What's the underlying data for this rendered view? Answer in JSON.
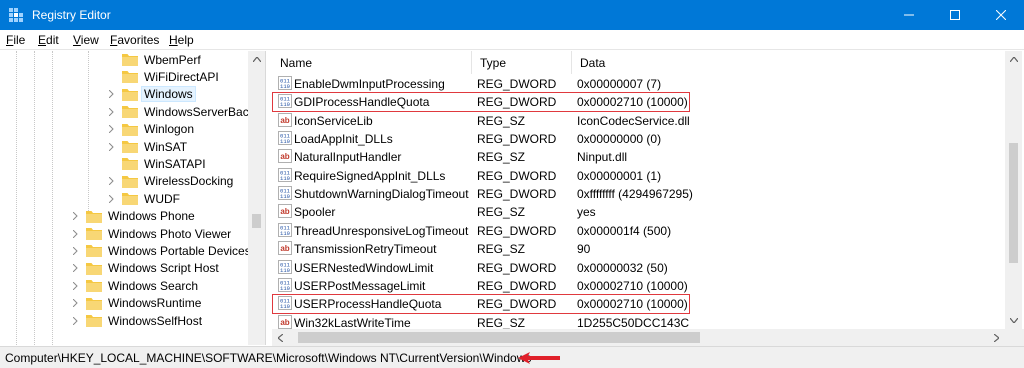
{
  "window": {
    "title": "Registry Editor",
    "accent": "#0078d7"
  },
  "menu": [
    {
      "label": "File",
      "underline": "F",
      "rest": "ile"
    },
    {
      "label": "Edit",
      "underline": "E",
      "rest": "dit"
    },
    {
      "label": "View",
      "underline": "V",
      "rest": "iew"
    },
    {
      "label": "Favorites",
      "underline": "F",
      "rest": "avorites"
    },
    {
      "label": "Help",
      "underline": "H",
      "rest": "elp"
    }
  ],
  "tree": {
    "items": [
      {
        "label": "WbemPerf",
        "expandable": false,
        "selected": false
      },
      {
        "label": "WiFiDirectAPI",
        "expandable": false,
        "selected": false
      },
      {
        "label": "Windows",
        "expandable": true,
        "selected": true
      },
      {
        "label": "WindowsServerBacku",
        "expandable": true,
        "selected": false
      },
      {
        "label": "Winlogon",
        "expandable": true,
        "selected": false
      },
      {
        "label": "WinSAT",
        "expandable": true,
        "selected": false
      },
      {
        "label": "WinSATAPI",
        "expandable": false,
        "selected": false
      },
      {
        "label": "WirelessDocking",
        "expandable": true,
        "selected": false
      },
      {
        "label": "WUDF",
        "expandable": true,
        "selected": false
      },
      {
        "label": "Windows Phone",
        "expandable": true,
        "selected": false
      },
      {
        "label": "Windows Photo Viewer",
        "expandable": true,
        "selected": false
      },
      {
        "label": "Windows Portable Devices",
        "expandable": true,
        "selected": false
      },
      {
        "label": "Windows Script Host",
        "expandable": true,
        "selected": false
      },
      {
        "label": "Windows Search",
        "expandable": true,
        "selected": false
      },
      {
        "label": "WindowsRuntime",
        "expandable": true,
        "selected": false
      },
      {
        "label": "WindowsSelfHost",
        "expandable": true,
        "selected": false
      }
    ]
  },
  "list": {
    "columns": [
      "Name",
      "Type",
      "Data"
    ],
    "rows": [
      {
        "icon": "dword-icon",
        "name": "EnableDwmInputProcessing",
        "type": "REG_DWORD",
        "data": "0x00000007 (7)",
        "highlighted": false
      },
      {
        "icon": "dword-icon",
        "name": "GDIProcessHandleQuota",
        "type": "REG_DWORD",
        "data": "0x00002710 (10000)",
        "highlighted": true
      },
      {
        "icon": "string-icon",
        "name": "IconServiceLib",
        "type": "REG_SZ",
        "data": "IconCodecService.dll",
        "highlighted": false
      },
      {
        "icon": "dword-icon",
        "name": "LoadAppInit_DLLs",
        "type": "REG_DWORD",
        "data": "0x00000000 (0)",
        "highlighted": false
      },
      {
        "icon": "string-icon",
        "name": "NaturalInputHandler",
        "type": "REG_SZ",
        "data": "Ninput.dll",
        "highlighted": false
      },
      {
        "icon": "dword-icon",
        "name": "RequireSignedAppInit_DLLs",
        "type": "REG_DWORD",
        "data": "0x00000001 (1)",
        "highlighted": false
      },
      {
        "icon": "dword-icon",
        "name": "ShutdownWarningDialogTimeout",
        "type": "REG_DWORD",
        "data": "0xffffffff (4294967295)",
        "highlighted": false
      },
      {
        "icon": "string-icon",
        "name": "Spooler",
        "type": "REG_SZ",
        "data": "yes",
        "highlighted": false
      },
      {
        "icon": "dword-icon",
        "name": "ThreadUnresponsiveLogTimeout",
        "type": "REG_DWORD",
        "data": "0x000001f4 (500)",
        "highlighted": false
      },
      {
        "icon": "string-icon",
        "name": "TransmissionRetryTimeout",
        "type": "REG_SZ",
        "data": "90",
        "highlighted": false
      },
      {
        "icon": "dword-icon",
        "name": "USERNestedWindowLimit",
        "type": "REG_DWORD",
        "data": "0x00000032 (50)",
        "highlighted": false
      },
      {
        "icon": "dword-icon",
        "name": "USERPostMessageLimit",
        "type": "REG_DWORD",
        "data": "0x00002710 (10000)",
        "highlighted": false
      },
      {
        "icon": "dword-icon",
        "name": "USERProcessHandleQuota",
        "type": "REG_DWORD",
        "data": "0x00002710 (10000)",
        "highlighted": true
      },
      {
        "icon": "string-icon",
        "name": "Win32kLastWriteTime",
        "type": "REG_SZ",
        "data": "1D255C50DCC143C",
        "highlighted": false
      }
    ]
  },
  "status": {
    "path": "Computer\\HKEY_LOCAL_MACHINE\\SOFTWARE\\Microsoft\\Windows NT\\CurrentVersion\\Windows",
    "annotation_color": "#e0202a"
  },
  "colors": {
    "highlight_box": "#e0393e",
    "folder": "#f5c842",
    "selection": "#e5f3ff"
  }
}
